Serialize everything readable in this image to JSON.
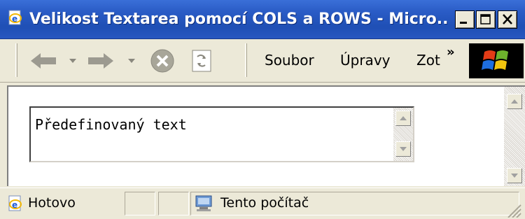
{
  "window": {
    "title": "Velikost Textarea pomocí COLS a ROWS - Micro...",
    "controls": {
      "minimize": "minimize-icon",
      "maximize": "maximize-icon",
      "close": "close-icon"
    }
  },
  "toolbar": {
    "menus": [
      "Soubor",
      "Úpravy",
      "Zot"
    ],
    "overflow": "»"
  },
  "page": {
    "textarea_value": "Předefinovaný text"
  },
  "status": {
    "state": "Hotovo",
    "zone": "Tento počítač"
  },
  "colors": {
    "titlebar": "#2A5CC6",
    "chrome": "#ECE9D8"
  }
}
